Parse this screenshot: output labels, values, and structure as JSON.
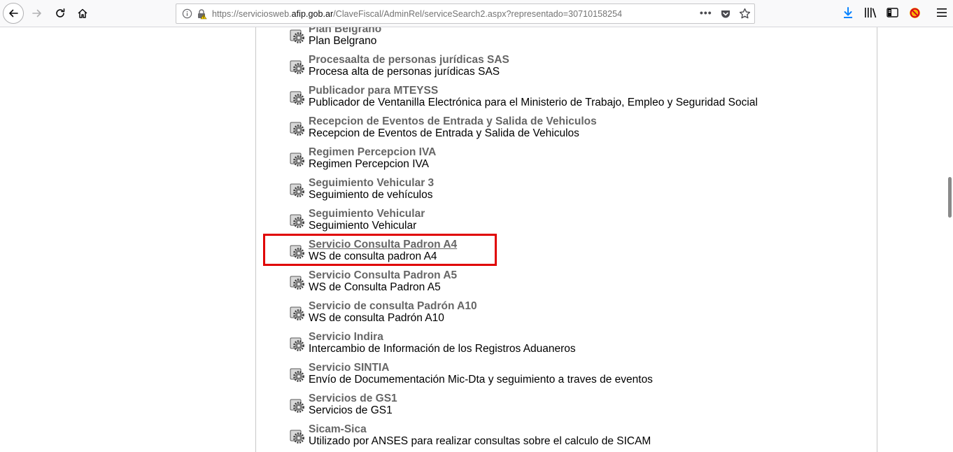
{
  "browser": {
    "url_prefix": "https://serviciosweb.",
    "url_domain": "afip.gob.ar",
    "url_path": "/ClaveFiscal/AdminRel/serviceSearch2.aspx?representado=30710158254",
    "page_actions_label": "•••"
  },
  "services": [
    {
      "name": "Plan Belgrano",
      "description": "Plan Belgrano"
    },
    {
      "name": "Procesaalta de personas jurídicas SAS",
      "description": "Procesa alta de personas jurídicas SAS"
    },
    {
      "name": "Publicador para MTEYSS",
      "description": "Publicador de Ventanilla Electrónica para el Ministerio de Trabajo, Empleo y Seguridad Social"
    },
    {
      "name": "Recepcion de Eventos de Entrada y Salida de Vehiculos",
      "description": "Recepcion de Eventos de Entrada y Salida de Vehiculos"
    },
    {
      "name": "Regimen Percepcion IVA",
      "description": "Regimen Percepcion IVA"
    },
    {
      "name": "Seguimiento Vehicular 3",
      "description": "Seguimiento de vehículos"
    },
    {
      "name": "Seguimiento Vehicular",
      "description": "Seguimiento Vehicular"
    },
    {
      "name": "Servicio Consulta Padron A4",
      "description": "WS de consulta padron A4"
    },
    {
      "name": "Servicio Consulta Padron A5",
      "description": "WS de Consulta Padron A5"
    },
    {
      "name": "Servicio de consulta Padrón A10",
      "description": "WS de consulta Padrón A10"
    },
    {
      "name": "Servicio Indira",
      "description": "Intercambio de Información de los Registros Aduaneros"
    },
    {
      "name": "Servicio SINTIA",
      "description": "Envío de Documementación Mic-Dta y seguimiento a traves de eventos"
    },
    {
      "name": "Servicios de GS1",
      "description": "Servicios de GS1"
    },
    {
      "name": "Sicam-Sica",
      "description": "Utilizado por ANSES para realizar consultas sobre el calculo de SICAM"
    }
  ],
  "highlight": {
    "index": 7,
    "color": "#e00000"
  },
  "colors": {
    "service_name": "#666666",
    "description": "#000000",
    "panel_border": "#c8c8c8"
  }
}
